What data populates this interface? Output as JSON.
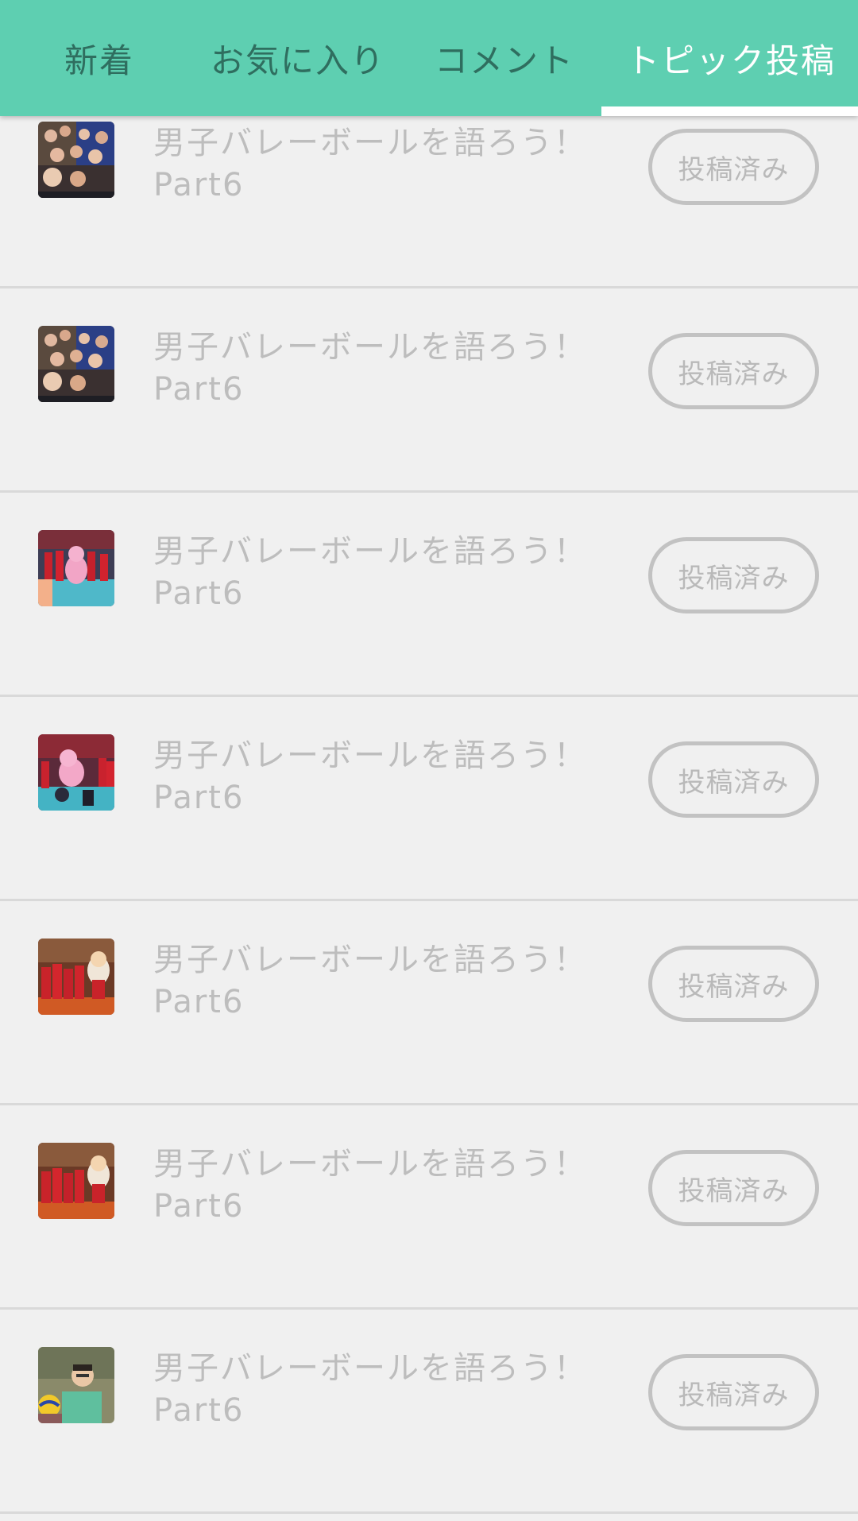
{
  "tabs": [
    {
      "label": "新着",
      "active": false
    },
    {
      "label": "お気に入り",
      "active": false
    },
    {
      "label": "コメント",
      "active": false
    },
    {
      "label": "トピック投稿",
      "active": true
    }
  ],
  "colors": {
    "tab_bar": "#5ecfb1",
    "tab_text": "#2f6e5f",
    "tab_active_text": "#ffffff",
    "background": "#f0f0f0",
    "muted_text": "#bdbdbd"
  },
  "topics": [
    {
      "title_line1": "男子バレーボールを語ろう！",
      "title_line2": "Part6",
      "status": "投稿済み",
      "thumbnail": "team-selfie-photo"
    },
    {
      "title_line1": "男子バレーボールを語ろう！",
      "title_line2": "Part6",
      "status": "投稿済み",
      "thumbnail": "team-selfie-photo"
    },
    {
      "title_line1": "男子バレーボールを語ろう！",
      "title_line2": "Part6",
      "status": "投稿済み",
      "thumbnail": "team-mascot-court-photo"
    },
    {
      "title_line1": "男子バレーボールを語ろう！",
      "title_line2": "Part6",
      "status": "投稿済み",
      "thumbnail": "team-mascot-court-photo"
    },
    {
      "title_line1": "男子バレーボールを語ろう！",
      "title_line2": "Part6",
      "status": "投稿済み",
      "thumbnail": "team-red-arena-photo"
    },
    {
      "title_line1": "男子バレーボールを語ろう！",
      "title_line2": "Part6",
      "status": "投稿済み",
      "thumbnail": "team-red-arena-photo"
    },
    {
      "title_line1": "男子バレーボールを語ろう！",
      "title_line2": "Part6",
      "status": "投稿済み",
      "thumbnail": "player-portrait-photo"
    }
  ]
}
